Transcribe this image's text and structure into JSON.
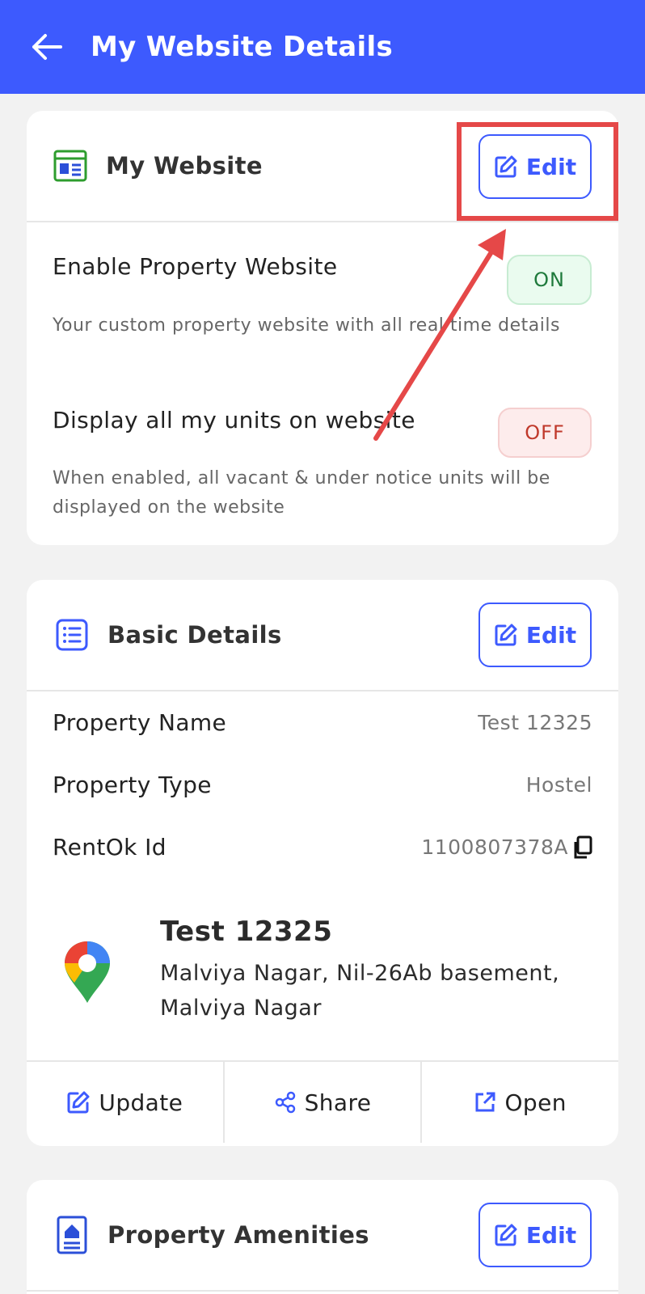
{
  "appbar": {
    "title": "My Website Details",
    "back_icon": "arrow-left-icon"
  },
  "my_website": {
    "title": "My Website",
    "edit_label": "Edit",
    "enable_label": "Enable Property Website",
    "enable_state": "ON",
    "enable_desc": "Your custom property website with all real time details",
    "display_label": "Display all my units on website",
    "display_state": "OFF",
    "display_desc": "When enabled, all vacant & under notice units will be displayed on the website"
  },
  "basic_details": {
    "title": "Basic Details",
    "edit_label": "Edit",
    "rows": [
      {
        "label": "Property Name",
        "value": "Test 12325"
      },
      {
        "label": "Property Type",
        "value": "Hostel"
      },
      {
        "label": "RentOk Id",
        "value": "1100807378A"
      }
    ],
    "location": {
      "name": "Test 12325",
      "address": "Malviya Nagar, Nil-26Ab basement, Malviya Nagar"
    },
    "actions": {
      "update": "Update",
      "share": "Share",
      "open": "Open"
    }
  },
  "amenities": {
    "title": "Property Amenities",
    "edit_label": "Edit"
  },
  "colors": {
    "primary": "#3d5afe",
    "on": "#1f7a3c",
    "off": "#c0392b",
    "annotation": "#e54848"
  }
}
